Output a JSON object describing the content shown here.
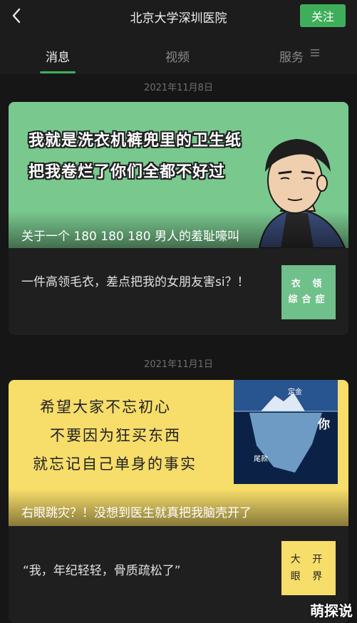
{
  "header": {
    "title": "北京大学深圳医院",
    "follow_label": "关注"
  },
  "tabs": [
    {
      "label": "消息"
    },
    {
      "label": "视频"
    },
    {
      "label": "服务"
    }
  ],
  "colors": {
    "accent": "#3fae5b",
    "card1_banner": "#79c98f",
    "card2_banner": "#f7dd6a"
  },
  "posts": [
    {
      "date": "2021年11月8日",
      "banner_lines": [
        "我就是洗衣机裤兜里的卫生纸",
        "把我卷烂了你们全都不好过"
      ],
      "main_title": "关于一个 180 180 180 男人的羞耻嚎叫",
      "sub_title": "一件高领毛衣，差点把我的女朋友害si？！",
      "thumb_lines": [
        "衣 领",
        "综合症"
      ]
    },
    {
      "date": "2021年11月1日",
      "banner_lines": [
        "希望大家不忘初心",
        "不要因为狂买东西",
        "就忘记自己单身的事实"
      ],
      "iceberg_labels": {
        "top": "定金",
        "middle": "你",
        "bottom": "尾款"
      },
      "main_title": "右眼跳灾？！没想到医生就真把我脑壳开了",
      "sub_title": "“我，年纪轻轻，骨质疏松了”",
      "thumb_lines": [
        "大 开",
        "眼 界"
      ]
    }
  ],
  "watermark": "萌探说"
}
